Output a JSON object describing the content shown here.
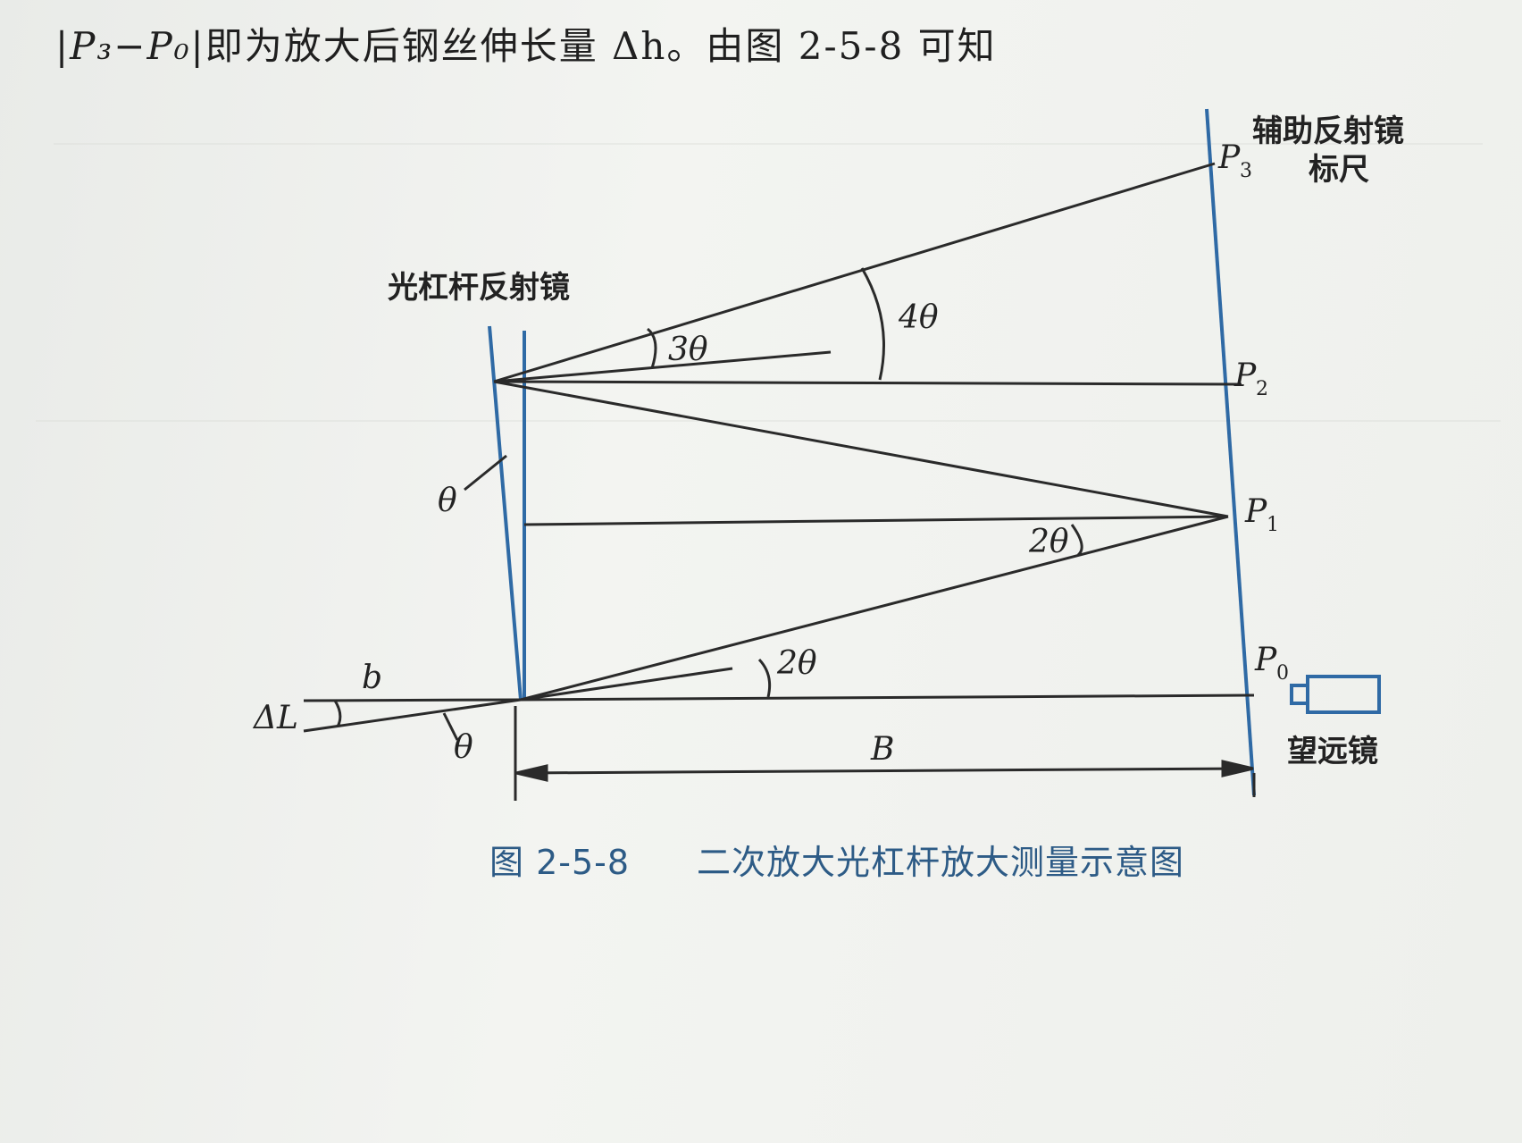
{
  "header_text": {
    "prefix": "|P₃−P₀|",
    "body": "即为放大后钢丝伸长量 Δh。由图 2-5-8 可知"
  },
  "labels": {
    "lever_mirror": "光杠杆反射镜",
    "aux_mirror": "辅助反射镜",
    "scale": "标尺",
    "telescope": "望远镜"
  },
  "points": {
    "p3": {
      "main": "P",
      "sub": "3"
    },
    "p2": {
      "main": "P",
      "sub": "2"
    },
    "p1": {
      "main": "P",
      "sub": "1"
    },
    "p0": {
      "main": "P",
      "sub": "0"
    }
  },
  "angles": {
    "three_theta": "3θ",
    "four_theta": "4θ",
    "two_theta_upper": "2θ",
    "two_theta_lower": "2θ",
    "theta_mirror": "θ",
    "theta_lever": "θ"
  },
  "symbols": {
    "b": "b",
    "delta_l": "ΔL",
    "big_b": "B"
  },
  "caption": {
    "number": "图 2-5-8",
    "title": "二次放大光杠杆放大测量示意图"
  },
  "colors": {
    "mirror_blue": "#2f6aa5",
    "line_dark": "#2a2a2a",
    "caption_blue": "#2d5b86"
  }
}
